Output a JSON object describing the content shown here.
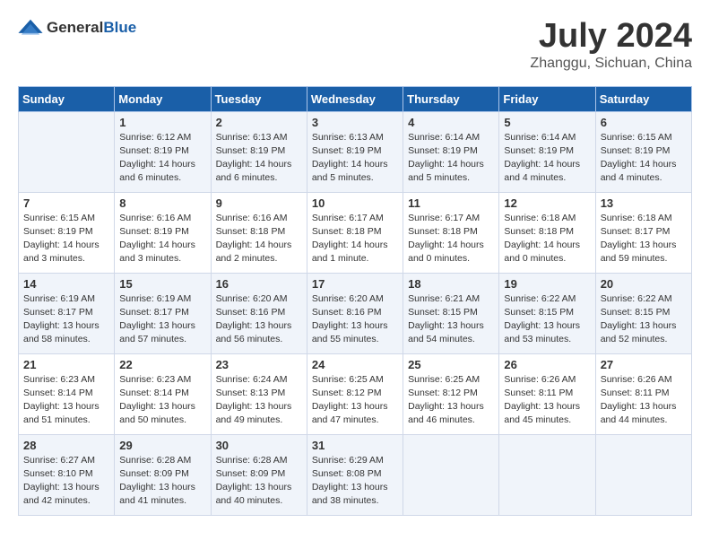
{
  "logo": {
    "general": "General",
    "blue": "Blue"
  },
  "title": {
    "month_year": "July 2024",
    "location": "Zhanggu, Sichuan, China"
  },
  "calendar": {
    "headers": [
      "Sunday",
      "Monday",
      "Tuesday",
      "Wednesday",
      "Thursday",
      "Friday",
      "Saturday"
    ],
    "weeks": [
      [
        {
          "day": "",
          "info": ""
        },
        {
          "day": "1",
          "info": "Sunrise: 6:12 AM\nSunset: 8:19 PM\nDaylight: 14 hours\nand 6 minutes."
        },
        {
          "day": "2",
          "info": "Sunrise: 6:13 AM\nSunset: 8:19 PM\nDaylight: 14 hours\nand 6 minutes."
        },
        {
          "day": "3",
          "info": "Sunrise: 6:13 AM\nSunset: 8:19 PM\nDaylight: 14 hours\nand 5 minutes."
        },
        {
          "day": "4",
          "info": "Sunrise: 6:14 AM\nSunset: 8:19 PM\nDaylight: 14 hours\nand 5 minutes."
        },
        {
          "day": "5",
          "info": "Sunrise: 6:14 AM\nSunset: 8:19 PM\nDaylight: 14 hours\nand 4 minutes."
        },
        {
          "day": "6",
          "info": "Sunrise: 6:15 AM\nSunset: 8:19 PM\nDaylight: 14 hours\nand 4 minutes."
        }
      ],
      [
        {
          "day": "7",
          "info": "Sunrise: 6:15 AM\nSunset: 8:19 PM\nDaylight: 14 hours\nand 3 minutes."
        },
        {
          "day": "8",
          "info": "Sunrise: 6:16 AM\nSunset: 8:19 PM\nDaylight: 14 hours\nand 3 minutes."
        },
        {
          "day": "9",
          "info": "Sunrise: 6:16 AM\nSunset: 8:18 PM\nDaylight: 14 hours\nand 2 minutes."
        },
        {
          "day": "10",
          "info": "Sunrise: 6:17 AM\nSunset: 8:18 PM\nDaylight: 14 hours\nand 1 minute."
        },
        {
          "day": "11",
          "info": "Sunrise: 6:17 AM\nSunset: 8:18 PM\nDaylight: 14 hours\nand 0 minutes."
        },
        {
          "day": "12",
          "info": "Sunrise: 6:18 AM\nSunset: 8:18 PM\nDaylight: 14 hours\nand 0 minutes."
        },
        {
          "day": "13",
          "info": "Sunrise: 6:18 AM\nSunset: 8:17 PM\nDaylight: 13 hours\nand 59 minutes."
        }
      ],
      [
        {
          "day": "14",
          "info": "Sunrise: 6:19 AM\nSunset: 8:17 PM\nDaylight: 13 hours\nand 58 minutes."
        },
        {
          "day": "15",
          "info": "Sunrise: 6:19 AM\nSunset: 8:17 PM\nDaylight: 13 hours\nand 57 minutes."
        },
        {
          "day": "16",
          "info": "Sunrise: 6:20 AM\nSunset: 8:16 PM\nDaylight: 13 hours\nand 56 minutes."
        },
        {
          "day": "17",
          "info": "Sunrise: 6:20 AM\nSunset: 8:16 PM\nDaylight: 13 hours\nand 55 minutes."
        },
        {
          "day": "18",
          "info": "Sunrise: 6:21 AM\nSunset: 8:15 PM\nDaylight: 13 hours\nand 54 minutes."
        },
        {
          "day": "19",
          "info": "Sunrise: 6:22 AM\nSunset: 8:15 PM\nDaylight: 13 hours\nand 53 minutes."
        },
        {
          "day": "20",
          "info": "Sunrise: 6:22 AM\nSunset: 8:15 PM\nDaylight: 13 hours\nand 52 minutes."
        }
      ],
      [
        {
          "day": "21",
          "info": "Sunrise: 6:23 AM\nSunset: 8:14 PM\nDaylight: 13 hours\nand 51 minutes."
        },
        {
          "day": "22",
          "info": "Sunrise: 6:23 AM\nSunset: 8:14 PM\nDaylight: 13 hours\nand 50 minutes."
        },
        {
          "day": "23",
          "info": "Sunrise: 6:24 AM\nSunset: 8:13 PM\nDaylight: 13 hours\nand 49 minutes."
        },
        {
          "day": "24",
          "info": "Sunrise: 6:25 AM\nSunset: 8:12 PM\nDaylight: 13 hours\nand 47 minutes."
        },
        {
          "day": "25",
          "info": "Sunrise: 6:25 AM\nSunset: 8:12 PM\nDaylight: 13 hours\nand 46 minutes."
        },
        {
          "day": "26",
          "info": "Sunrise: 6:26 AM\nSunset: 8:11 PM\nDaylight: 13 hours\nand 45 minutes."
        },
        {
          "day": "27",
          "info": "Sunrise: 6:26 AM\nSunset: 8:11 PM\nDaylight: 13 hours\nand 44 minutes."
        }
      ],
      [
        {
          "day": "28",
          "info": "Sunrise: 6:27 AM\nSunset: 8:10 PM\nDaylight: 13 hours\nand 42 minutes."
        },
        {
          "day": "29",
          "info": "Sunrise: 6:28 AM\nSunset: 8:09 PM\nDaylight: 13 hours\nand 41 minutes."
        },
        {
          "day": "30",
          "info": "Sunrise: 6:28 AM\nSunset: 8:09 PM\nDaylight: 13 hours\nand 40 minutes."
        },
        {
          "day": "31",
          "info": "Sunrise: 6:29 AM\nSunset: 8:08 PM\nDaylight: 13 hours\nand 38 minutes."
        },
        {
          "day": "",
          "info": ""
        },
        {
          "day": "",
          "info": ""
        },
        {
          "day": "",
          "info": ""
        }
      ]
    ]
  }
}
